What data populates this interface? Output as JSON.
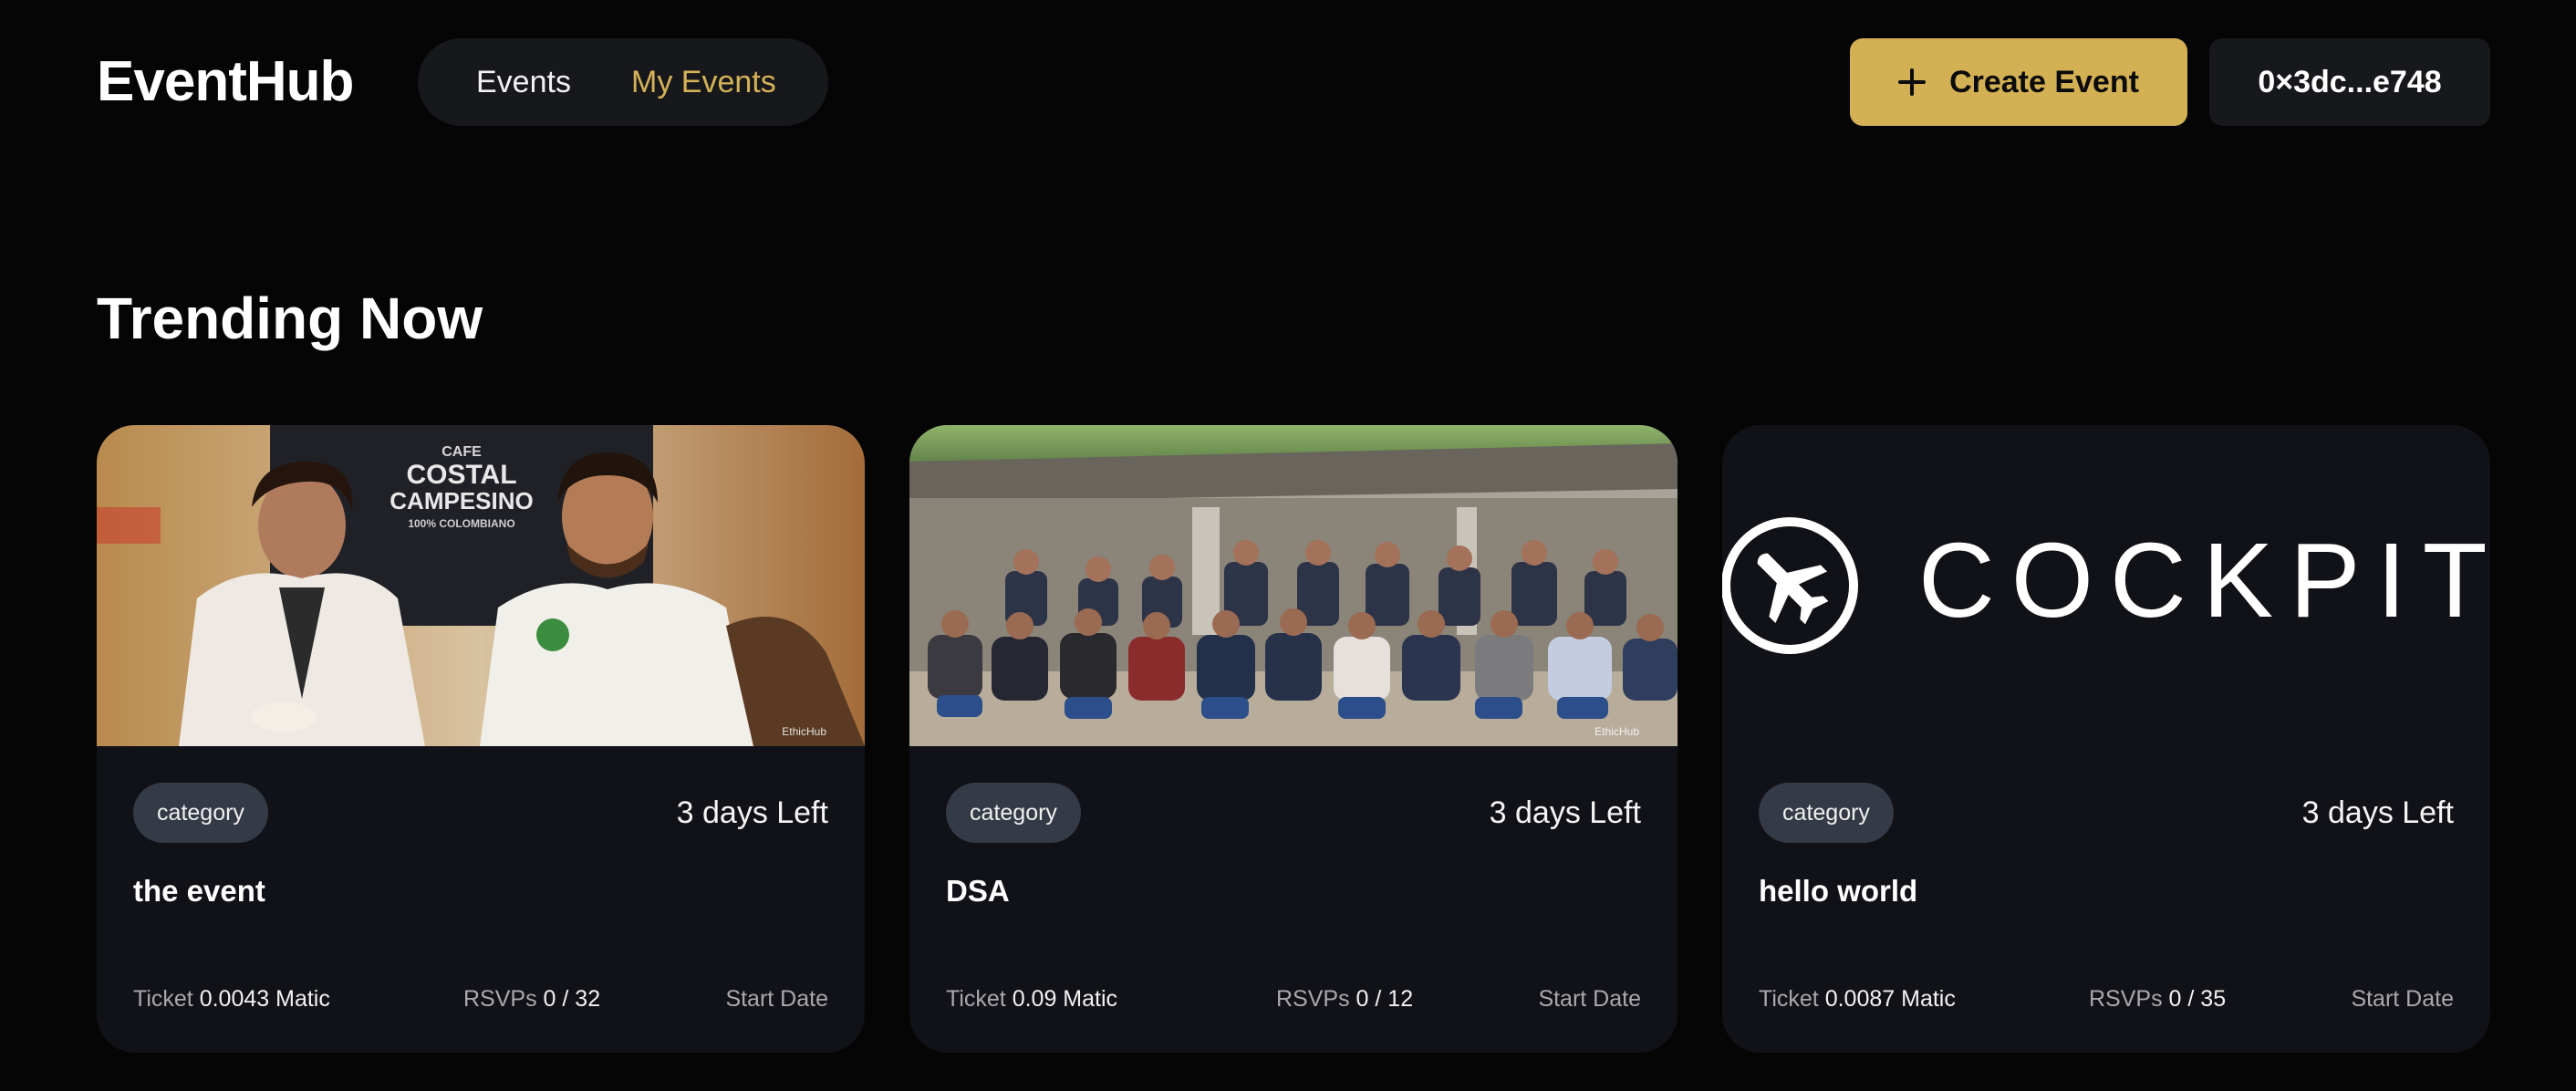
{
  "header": {
    "logo": "EventHub",
    "nav": [
      "Events",
      "My Events"
    ],
    "active_nav": "My Events",
    "create_label": "Create Event",
    "wallet": "0×3dc...e748"
  },
  "main": {
    "section_title": "Trending Now",
    "cards": [
      {
        "category": "category",
        "days_left": "3 days Left",
        "title": "the event",
        "ticket_label": "Ticket",
        "ticket_value": "0.0043 Matic",
        "rsvp_label": "RSVPs",
        "rsvp_value": "0 / 32",
        "start_label": "Start Date",
        "image_text_1": "CAFE",
        "image_text_2": "COSTAL",
        "image_text_3": "CAMPESINO",
        "image_text_4": "100% COLOMBIANO",
        "watermark": "EthicHub"
      },
      {
        "category": "category",
        "days_left": "3 days Left",
        "title": "DSA",
        "ticket_label": "Ticket",
        "ticket_value": "0.09 Matic",
        "rsvp_label": "RSVPs",
        "rsvp_value": "0 / 12",
        "start_label": "Start Date",
        "watermark": "EthicHub"
      },
      {
        "category": "category",
        "days_left": "3 days Left",
        "title": "hello world",
        "ticket_label": "Ticket",
        "ticket_value": "0.0087 Matic",
        "rsvp_label": "RSVPs",
        "rsvp_value": "0 / 35",
        "start_label": "Start Date",
        "logo_text": "COCKPIT"
      }
    ]
  },
  "colors": {
    "background": "#050505",
    "accent": "#d3b053",
    "card": "#111217",
    "pill": "#353a47"
  },
  "icons": [
    "plus-icon",
    "airplane-icon"
  ]
}
